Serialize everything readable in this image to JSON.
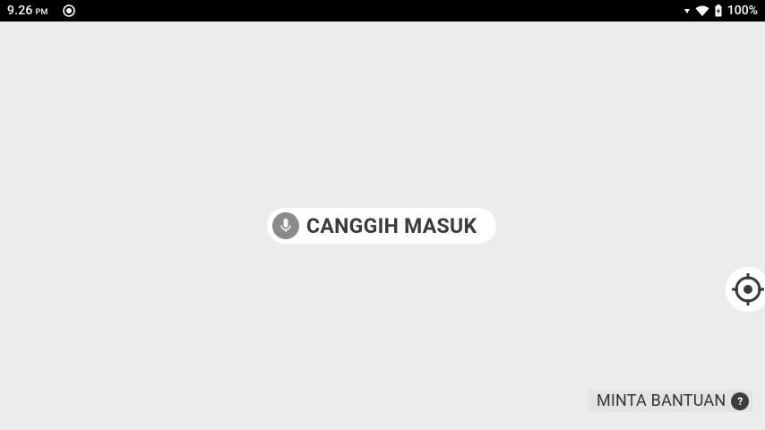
{
  "status_bar": {
    "time": "9.26",
    "ampm": "PM",
    "battery_percent": "100%",
    "icons": [
      "camera-lens-icon",
      "signal-arrow-icon",
      "wifi-icon",
      "battery-charging-icon"
    ]
  },
  "voice_control": {
    "label": "CANGGIH MASUK",
    "icon": "microphone-icon"
  },
  "locate_control": {
    "icon": "crosshair-icon"
  },
  "help": {
    "label": "MINTA BANTUAN",
    "icon_glyph": "?"
  },
  "colors": {
    "background": "#ececec",
    "status_bar": "#000000",
    "pill": "#ffffff",
    "mic_circle": "#8a8a8a",
    "text_dark": "#3a3a3a",
    "help_icon": "#3c3c3c"
  }
}
